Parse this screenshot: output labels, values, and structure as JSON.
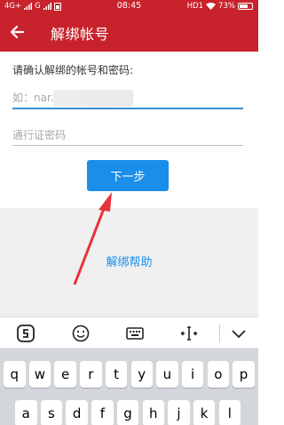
{
  "status_bar": {
    "network": "4G+",
    "signal2": "G",
    "time": "08:45",
    "hd": "HD1",
    "battery": "73%",
    "battery_level": 0.73
  },
  "app_bar": {
    "title": "解绑帐号",
    "back_icon": "arrow-left-icon"
  },
  "form": {
    "prompt": "请确认解绑的帐号和密码:",
    "account": {
      "value": "如：nar...com",
      "placeholder": "如：nar... .com"
    },
    "password": {
      "placeholder": "通行证密码"
    },
    "next_button": "下一步"
  },
  "help_link": "解绑帮助",
  "keyboard_toolbar": {
    "items": [
      "sogou-logo-icon",
      "emoji-icon",
      "keyboard-icon",
      "cursor-move-icon",
      "chevron-down-icon"
    ]
  },
  "keyboard": {
    "row1": [
      "q",
      "w",
      "e",
      "r",
      "t",
      "y",
      "u",
      "i",
      "o",
      "p"
    ],
    "row2": [
      "a",
      "s",
      "d",
      "f",
      "g",
      "h",
      "j",
      "k",
      "l"
    ]
  },
  "colors": {
    "header": "#c8232c",
    "accent": "#1a8ee8",
    "annotation": "#e8323a"
  }
}
